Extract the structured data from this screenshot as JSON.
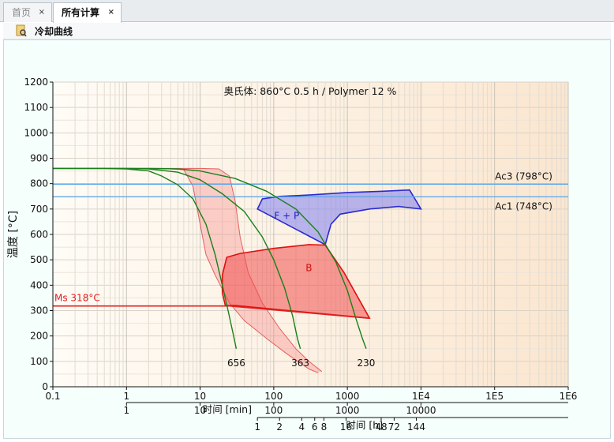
{
  "tabs": [
    {
      "label": "首页",
      "close": "×"
    },
    {
      "label": "所有计算",
      "close": "×"
    }
  ],
  "toolbar": {
    "icon": "document-search-icon",
    "label": "冷却曲线"
  },
  "chart_data": {
    "type": "line",
    "title": "奥氏体: 860°C 0.5 h / Polymer 12 %",
    "ylabel": "温度 [°C]",
    "xlabel": "时间 [min]",
    "xlabel2": "时间 [h]",
    "x_scale": "log",
    "xlim": [
      0.1,
      1000000
    ],
    "ylim": [
      0,
      1200
    ],
    "grid": true,
    "y_ticks": [
      "0",
      "100",
      "200",
      "300",
      "400",
      "500",
      "600",
      "700",
      "800",
      "900",
      "1000",
      "1100",
      "1200"
    ],
    "x_ticks": [
      "0.1",
      "1",
      "10",
      "100",
      "1000",
      "1E4",
      "1E5",
      "1E6"
    ],
    "h_axis_ticks": [
      "1",
      "10",
      "100",
      "1000",
      "10000"
    ],
    "h_axis_values": [
      "1",
      "2",
      "4",
      "6",
      "8",
      "16",
      "48",
      "72",
      "144"
    ],
    "reference_lines": [
      {
        "name": "Ac3 (798°C)",
        "y": 798,
        "color": "#5aa7e8"
      },
      {
        "name": "Ac1 (748°C)",
        "y": 748,
        "color": "#5aa7e8"
      },
      {
        "name": "Ms 318°C",
        "y": 318,
        "color": "#e02020"
      }
    ],
    "regions": [
      {
        "name": "F + P",
        "color": "#2a2ad0",
        "start": [
          [
            60,
            700
          ],
          [
            70,
            740
          ],
          [
            120,
            750
          ],
          [
            300,
            755
          ],
          [
            1000,
            765
          ],
          [
            3000,
            770
          ],
          [
            7000,
            775
          ]
        ],
        "finish": [
          [
            500,
            560
          ],
          [
            600,
            640
          ],
          [
            800,
            680
          ],
          [
            2000,
            700
          ],
          [
            5000,
            710
          ],
          [
            10000,
            700
          ]
        ]
      },
      {
        "name": "B",
        "color": "#e01010",
        "outline": [
          [
            22,
            320
          ],
          [
            20,
            370
          ],
          [
            20,
            440
          ],
          [
            23,
            510
          ],
          [
            35,
            525
          ],
          [
            100,
            545
          ],
          [
            300,
            560
          ],
          [
            500,
            558
          ],
          [
            900,
            450
          ],
          [
            2000,
            270
          ],
          [
            30,
            320
          ]
        ]
      }
    ],
    "cooling_curves": [
      {
        "name": "656",
        "color": "#1a7f1a",
        "points": [
          [
            0.1,
            860
          ],
          [
            0.5,
            860
          ],
          [
            1,
            858
          ],
          [
            2,
            850
          ],
          [
            3,
            830
          ],
          [
            5,
            795
          ],
          [
            8,
            740
          ],
          [
            12,
            640
          ],
          [
            16,
            520
          ],
          [
            20,
            400
          ],
          [
            24,
            300
          ],
          [
            28,
            210
          ],
          [
            31,
            150
          ]
        ]
      },
      {
        "name": "363",
        "color": "#1a7f1a",
        "points": [
          [
            0.1,
            860
          ],
          [
            1,
            860
          ],
          [
            2,
            858
          ],
          [
            5,
            845
          ],
          [
            10,
            815
          ],
          [
            20,
            760
          ],
          [
            40,
            690
          ],
          [
            70,
            590
          ],
          [
            100,
            500
          ],
          [
            140,
            390
          ],
          [
            180,
            280
          ],
          [
            210,
            190
          ],
          [
            230,
            150
          ]
        ]
      },
      {
        "name": "230",
        "color": "#1a7f1a",
        "points": [
          [
            0.1,
            860
          ],
          [
            2,
            860
          ],
          [
            5,
            858
          ],
          [
            10,
            850
          ],
          [
            30,
            820
          ],
          [
            80,
            770
          ],
          [
            200,
            700
          ],
          [
            400,
            610
          ],
          [
            700,
            490
          ],
          [
            1000,
            380
          ],
          [
            1300,
            270
          ],
          [
            1600,
            190
          ],
          [
            1800,
            150
          ]
        ]
      }
    ],
    "martensite_band": [
      {
        "name": "fast",
        "points": [
          [
            0.1,
            860
          ],
          [
            3,
            860
          ],
          [
            6,
            855
          ],
          [
            8,
            790
          ],
          [
            10,
            640
          ],
          [
            12,
            520
          ],
          [
            16,
            440
          ],
          [
            25,
            330
          ],
          [
            40,
            260
          ],
          [
            80,
            190
          ],
          [
            150,
            130
          ],
          [
            300,
            70
          ],
          [
            400,
            55
          ]
        ]
      },
      {
        "name": "slow",
        "points": [
          [
            0.1,
            860
          ],
          [
            10,
            860
          ],
          [
            18,
            858
          ],
          [
            25,
            830
          ],
          [
            30,
            730
          ],
          [
            35,
            590
          ],
          [
            45,
            450
          ],
          [
            70,
            330
          ],
          [
            120,
            230
          ],
          [
            200,
            150
          ],
          [
            300,
            100
          ],
          [
            450,
            60
          ]
        ]
      }
    ],
    "curve_labels": [
      "656",
      "363",
      "230"
    ]
  }
}
